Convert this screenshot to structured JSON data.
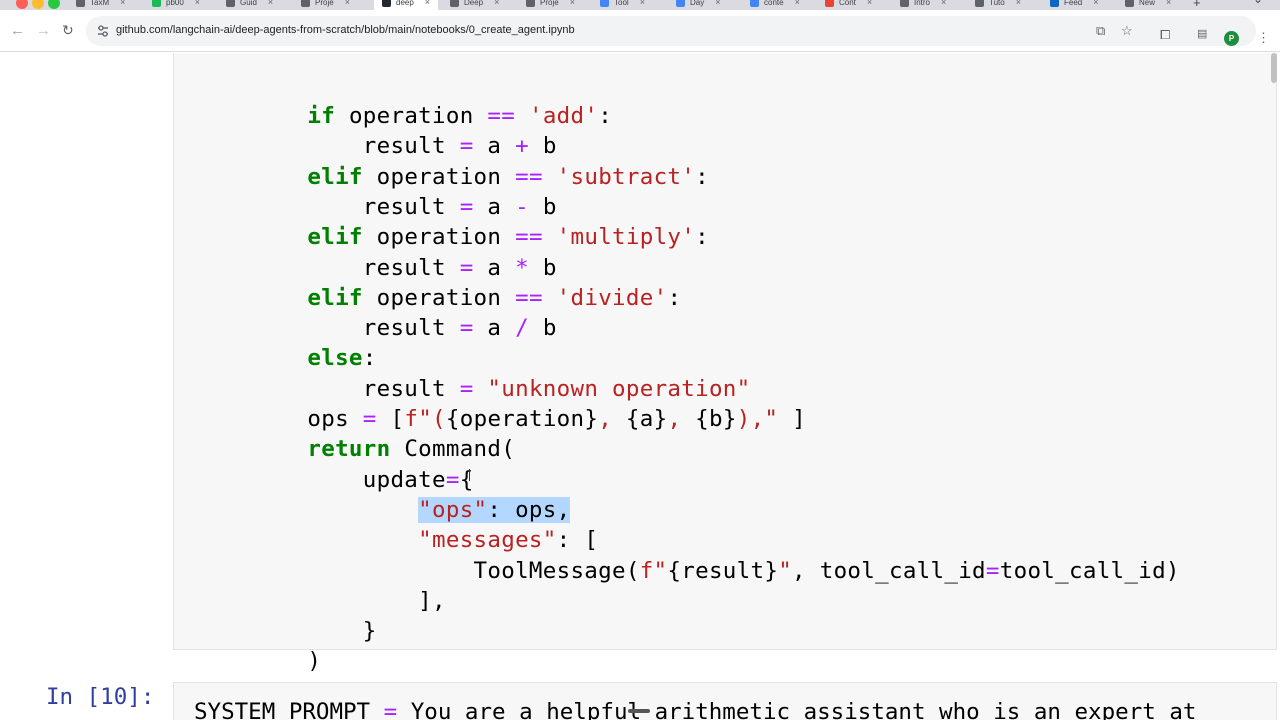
{
  "browser": {
    "tabs": [
      {
        "label": "TaxM",
        "color": "#5f6368"
      },
      {
        "label": "pb00",
        "color": "#1db954"
      },
      {
        "label": "Guid",
        "color": "#5f6368"
      },
      {
        "label": "Proje",
        "color": "#5f6368"
      },
      {
        "label": "deep",
        "color": "#24292f",
        "active": true
      },
      {
        "label": "Deep",
        "color": "#5f6368"
      },
      {
        "label": "Proje",
        "color": "#5f6368"
      },
      {
        "label": "Tool",
        "color": "#4285f4"
      },
      {
        "label": "Day",
        "color": "#4285f4"
      },
      {
        "label": "conte",
        "color": "#4285f4"
      },
      {
        "label": "Cont",
        "color": "#ea4335"
      },
      {
        "label": "Intro",
        "color": "#5f6368"
      },
      {
        "label": "Tuto",
        "color": "#5f6368"
      },
      {
        "label": "Feed",
        "color": "#0a66c2"
      },
      {
        "label": "New",
        "color": "#5f6368"
      }
    ],
    "new_tab": "+",
    "url": "github.com/langchain-ai/deep-agents-from-scratch/blob/main/notebooks/0_create_agent.ipynb",
    "profile_initial": "P",
    "accent": "#1e8e3e"
  },
  "notebook": {
    "code_cell_lines": [
      "    if operation == 'add':",
      "        result = a + b",
      "    elif operation == 'subtract':",
      "        result = a - b",
      "    elif operation == 'multiply':",
      "        result = a * b",
      "    elif operation == 'divide':",
      "        result = a / b",
      "    else:",
      "        result = \"unknown operation\"",
      "    ops = [f\"({operation}, {a}, {b}),\" ]",
      "    return Command(",
      "        update={",
      "            \"ops\": ops,",
      "            \"messages\": [",
      "                ToolMessage(f\"{result}\", tool_call_id=tool_call_id)",
      "            ],",
      "        }",
      "    )"
    ],
    "next_cell_prompt": "In [10]:",
    "next_cell_code": "SYSTEM_PROMPT = \"You are a helpful arithmetic assistant who is an expert at"
  }
}
